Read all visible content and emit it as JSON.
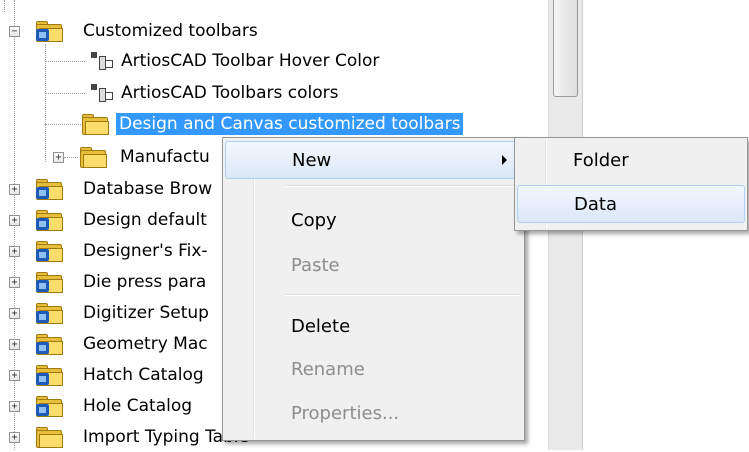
{
  "tree": {
    "items": [
      {
        "label": "Customized toolbars",
        "expander": "minus",
        "icon": "special-folder-icon"
      },
      {
        "label": "ArtiosCAD Toolbar Hover Color",
        "icon": "data-item-icon"
      },
      {
        "label": "ArtiosCAD Toolbars colors",
        "icon": "data-item-icon"
      },
      {
        "label": "Design and Canvas customized toolbars",
        "icon": "open-folder-icon",
        "selected": true
      },
      {
        "label": "Manufactu",
        "expander": "plus",
        "icon": "folder-icon"
      },
      {
        "label": "Database Brow",
        "expander": "plus",
        "icon": "special-folder-icon"
      },
      {
        "label": "Design default",
        "expander": "plus",
        "icon": "special-folder-icon"
      },
      {
        "label": "Designer's Fix-",
        "expander": "plus",
        "icon": "special-folder-icon"
      },
      {
        "label": "Die press para",
        "expander": "plus",
        "icon": "special-folder-icon"
      },
      {
        "label": "Digitizer Setup",
        "expander": "plus",
        "icon": "special-folder-icon"
      },
      {
        "label": "Geometry Mac",
        "expander": "plus",
        "icon": "special-folder-icon"
      },
      {
        "label": "Hatch Catalog",
        "expander": "plus",
        "icon": "special-folder-icon"
      },
      {
        "label": "Hole Catalog",
        "expander": "plus",
        "icon": "special-folder-icon"
      },
      {
        "label": "Import Typing Table",
        "expander": "plus",
        "icon": "folder-icon"
      }
    ]
  },
  "context_menu": {
    "items": [
      {
        "label": "New",
        "has_submenu": true,
        "enabled": true
      },
      {
        "label": "Copy",
        "enabled": true
      },
      {
        "label": "Paste",
        "enabled": false
      },
      {
        "label": "Delete",
        "enabled": true
      },
      {
        "label": "Rename",
        "enabled": false
      },
      {
        "label": "Properties...",
        "enabled": false
      }
    ]
  },
  "submenu": {
    "items": [
      {
        "label": "Folder"
      },
      {
        "label": "Data"
      }
    ]
  },
  "colors": {
    "selection": "#3399ff",
    "menu_background": "#f0f0f0",
    "menu_hover": "#dbe8f8",
    "disabled_text": "#8d8d8d"
  }
}
